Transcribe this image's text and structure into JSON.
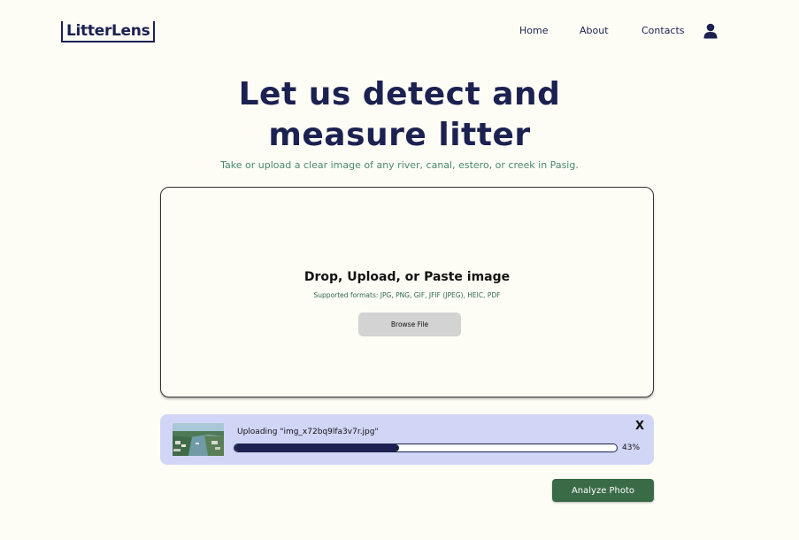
{
  "brand": {
    "logo_text": "LitterLens",
    "primary_color": "#1b2150",
    "accent_green": "#3a6b47"
  },
  "nav": {
    "home": "Home",
    "about": "About",
    "contacts": "Contacts",
    "user_icon": "user-icon"
  },
  "hero": {
    "line1": "Let us detect and",
    "line2": "measure litter",
    "subtitle": "Take or upload a clear image of any river, canal, estero, or creek in Pasig."
  },
  "dropzone": {
    "title": "Drop, Upload, or Paste image",
    "formats": "Supported formats: JPG, PNG, GIF, JFIF (JPEG), HEIC, PDF",
    "browse_label": "Browse File"
  },
  "upload": {
    "label": "Uploading \"img_x72bq9lfa3v7r.jpg\"",
    "close_label": "X",
    "progress_fraction": 0.43,
    "progress_text": "43%"
  },
  "actions": {
    "analyze_label": "Analyze Photo"
  }
}
